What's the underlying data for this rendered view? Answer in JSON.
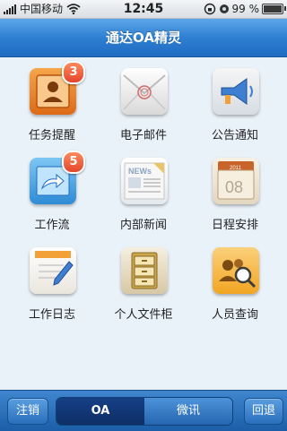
{
  "status": {
    "carrier": "中国移动",
    "time": "12:45",
    "battery": "99 %"
  },
  "header": {
    "title": "通达OA精灵"
  },
  "grid": {
    "items": [
      {
        "label": "任务提醒",
        "badge": "3",
        "icon": "task-reminder-icon"
      },
      {
        "label": "电子邮件",
        "badge": "",
        "icon": "email-icon"
      },
      {
        "label": "公告通知",
        "badge": "",
        "icon": "announcement-icon"
      },
      {
        "label": "工作流",
        "badge": "5",
        "icon": "workflow-icon"
      },
      {
        "label": "内部新闻",
        "badge": "",
        "icon": "news-icon"
      },
      {
        "label": "日程安排",
        "badge": "",
        "icon": "calendar-icon"
      },
      {
        "label": "工作日志",
        "badge": "",
        "icon": "work-log-icon"
      },
      {
        "label": "个人文件柜",
        "badge": "",
        "icon": "file-cabinet-icon"
      },
      {
        "label": "人员查询",
        "badge": "",
        "icon": "people-search-icon"
      }
    ],
    "news_icon_text": "NEWs",
    "calendar_icon_year": "2011",
    "calendar_icon_day": "08"
  },
  "tabbar": {
    "logout_label": "注销",
    "tab_oa_label": "OA",
    "tab_weixun_label": "微讯",
    "back_label": "回退"
  },
  "colors": {
    "accent": "#2e7fd3",
    "badge": "#e4452a"
  }
}
